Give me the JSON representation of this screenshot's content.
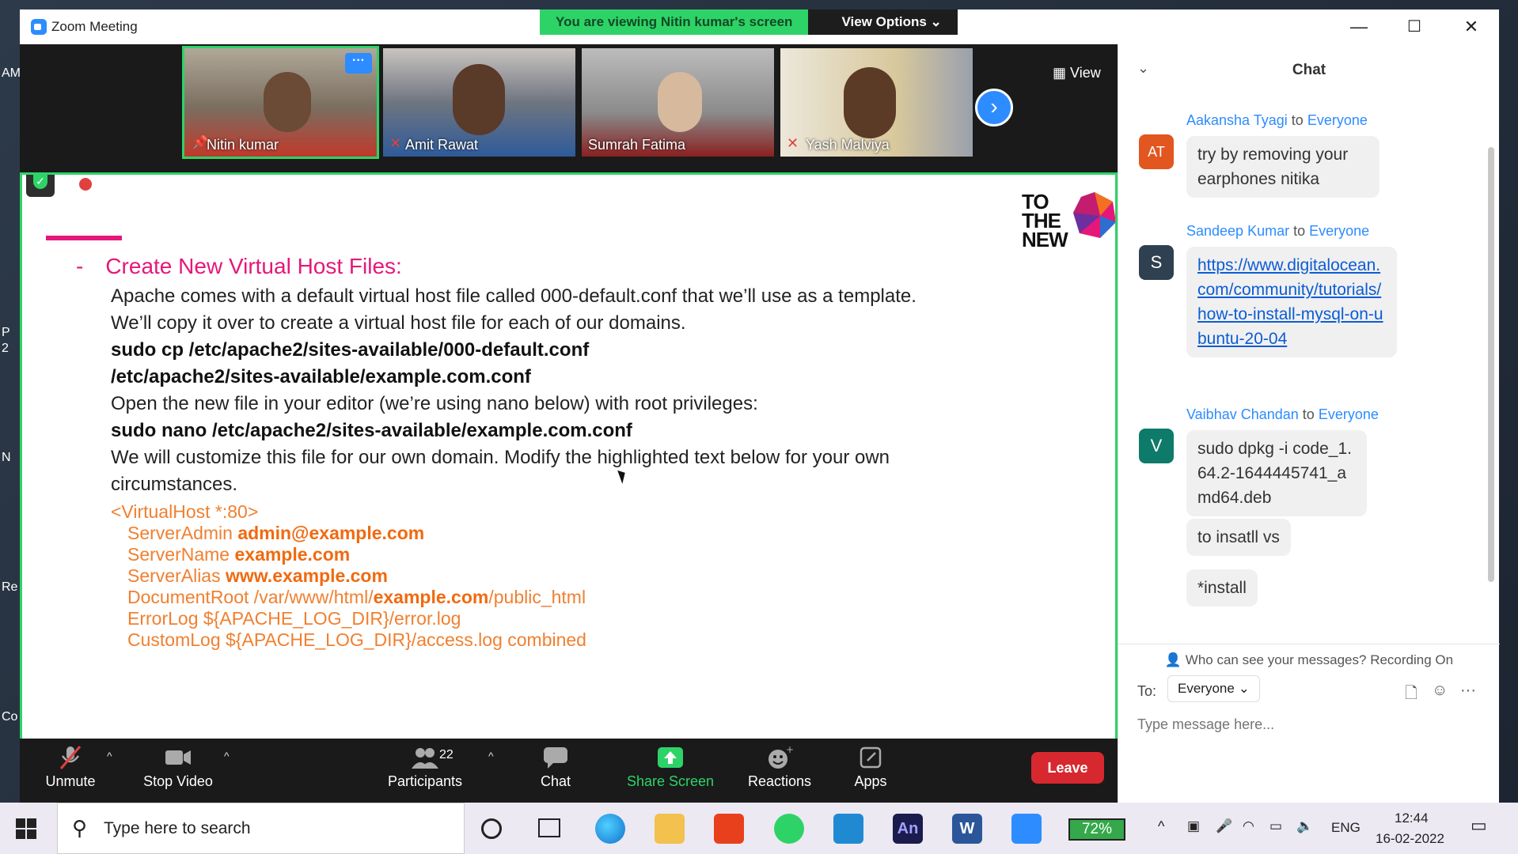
{
  "window": {
    "title": "Zoom Meeting",
    "minimize": "—",
    "maximize": "☐",
    "close": "✕"
  },
  "banner": {
    "viewing": "You are viewing Nitin kumar's screen",
    "view_options": "View Options ⌄"
  },
  "desktop_labels": [
    "AM",
    "P",
    "2",
    "N",
    "Re",
    "Co"
  ],
  "strip": {
    "view_label": "View",
    "next_arrow": "›",
    "tiles": [
      {
        "name": "Nitin kumar",
        "bg": "#8a8070",
        "active": true,
        "more": "···"
      },
      {
        "name": "Amit Rawat",
        "bg": "#4a5366",
        "active": false
      },
      {
        "name": "Sumrah Fatima",
        "bg": "#9a9aa2",
        "active": false
      },
      {
        "name": "Yash Malviya",
        "bg": "#7c7a6a",
        "active": false
      }
    ]
  },
  "slide": {
    "logo": "TO THE NEW",
    "bullet": "-",
    "heading": "Create New Virtual Host Files:",
    "lines": [
      "Apache comes with a default virtual host file called 000-default.conf that we’ll use as a template.",
      "We’ll copy it over to create a virtual host file for each of our domains.",
      "sudo cp /etc/apache2/sites-available/000-default.conf",
      "/etc/apache2/sites-available/example.com.conf",
      "Open the new file in your editor (we’re using nano below) with root privileges:",
      "sudo nano /etc/apache2/sites-available/example.com.conf",
      "We will customize this file for our own domain. Modify the highlighted text below for your own",
      "circumstances."
    ],
    "code": {
      "open": "<VirtualHost *:80>",
      "admin_key": "ServerAdmin ",
      "admin_val": "admin@example.com",
      "name_key": "ServerName ",
      "name_val": "example.com",
      "alias_key": "ServerAlias ",
      "alias_val": "www.example.com",
      "root_pre": "DocumentRoot /var/www/html/",
      "root_val": "example.com",
      "root_post": "/public_html",
      "errorlog": "ErrorLog ${APACHE_LOG_DIR}/error.log",
      "customlog": "CustomLog ${APACHE_LOG_DIR}/access.log combined"
    }
  },
  "toolbar": {
    "unmute": "Unmute",
    "stop_video": "Stop Video",
    "participants": "Participants",
    "participants_count": "22",
    "chat": "Chat",
    "share_screen": "Share Screen",
    "reactions": "Reactions",
    "apps": "Apps",
    "leave": "Leave",
    "caret": "^"
  },
  "chat": {
    "title": "Chat",
    "collapse": "⌄",
    "messages": [
      {
        "from": "Aakansha Tyagi",
        "to_word": "to",
        "to": "Everyone",
        "initials": "AT",
        "color": "#e2561f",
        "text": "try by removing your earphones nitika"
      },
      {
        "from": "Sandeep Kumar",
        "to_word": "to",
        "to": "Everyone",
        "initials": "S",
        "color": "#2f4050",
        "link": "https://www.digitalocean.com/community/tutorials/how-to-install-mysql-on-ubuntu-20-04"
      },
      {
        "from": "Vaibhav Chandan",
        "to_word": "to",
        "to": "Everyone",
        "initials": "V",
        "color": "#0e7a6a",
        "text": "sudo dpkg -i code_1.64.2-1644445741_amd64.deb"
      }
    ],
    "extra_messages": [
      "to insatll vs",
      "*install"
    ],
    "who_can_see": "Who can see your messages? Recording On",
    "to_label": "To:",
    "to_value": "Everyone",
    "placeholder": "Type message here..."
  },
  "taskbar": {
    "search_placeholder": "Type here to search",
    "battery": "72%",
    "lang": "ENG",
    "time": "12:44",
    "date": "16-02-2022",
    "an_label": "An",
    "w_label": "W"
  }
}
